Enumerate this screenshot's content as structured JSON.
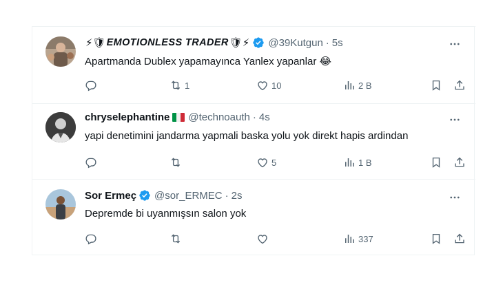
{
  "tweets": [
    {
      "name_prefix_emoji": "⚡🛡",
      "name": "EMOTIONLESS TRADER",
      "name_suffix_emoji": "🛡⚡",
      "verified": true,
      "handle": "@39Kutgun",
      "separator": "·",
      "time": "5s",
      "text": "Apartmanda Dublex yapamayınca Yanlex yapanlar 😂",
      "replies": "",
      "retweets": "1",
      "likes": "10",
      "views": "2 B"
    },
    {
      "name": "chryselephantine",
      "flag": "Italy",
      "verified": false,
      "handle": "@technoauth",
      "separator": "·",
      "time": "4s",
      "text": "yapi denetimini jandarma yapmali baska yolu yok direkt hapis ardindan",
      "replies": "",
      "retweets": "",
      "likes": "5",
      "views": "1 B"
    },
    {
      "name": "Sor Ermeç",
      "verified": true,
      "handle": "@sor_ERMEC",
      "separator": "·",
      "time": "2s",
      "text": "Depremde bi uyanmışsın salon yok",
      "replies": "",
      "retweets": "",
      "likes": "",
      "views": "337"
    }
  ],
  "colors": {
    "text": "#0f1419",
    "secondary": "#536471",
    "verified": "#1d9bf0",
    "divider": "#eff3f4"
  },
  "icons": [
    "reply-icon",
    "retweet-icon",
    "like-icon",
    "views-icon",
    "bookmark-icon",
    "share-icon",
    "more-icon",
    "verified-badge-icon"
  ]
}
